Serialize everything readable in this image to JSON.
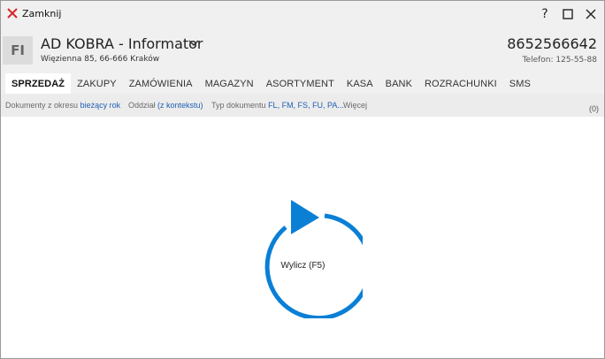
{
  "window": {
    "title": "Zamknij"
  },
  "window_controls": {
    "help": "?",
    "maximize_icon": "maximize-icon",
    "close_icon": "close-icon"
  },
  "header": {
    "avatar_initials": "FI",
    "company_name": "AD KOBRA - Informator",
    "address": "Więzienna  85, 66-666 Kraków",
    "nip": "8652566642",
    "phone": "Telefon: 125-55-88"
  },
  "tabs": [
    {
      "label": "SPRZEDAŻ",
      "active": true
    },
    {
      "label": "ZAKUPY"
    },
    {
      "label": "ZAMÓWIENIA"
    },
    {
      "label": "MAGAZYN"
    },
    {
      "label": "ASORTYMENT"
    },
    {
      "label": "KASA"
    },
    {
      "label": "BANK"
    },
    {
      "label": "ROZRACHUNKI"
    },
    {
      "label": "SMS"
    }
  ],
  "filters": {
    "period_label": "Dokumenty z okresu",
    "period_value": "bieżący rok",
    "branch_label": "Oddział",
    "branch_value": "(z kontekstu)",
    "doctype_label": "Typ dokumentu",
    "doctype_value": "FL, FM, FS, FU, PA...",
    "more_label": "Więcej",
    "count": "(0)"
  },
  "main": {
    "refresh_label": "Wylicz (F5)"
  },
  "colors": {
    "accent": "#0a7fd6",
    "close_red": "#d9262c",
    "link": "#1f5fb4"
  }
}
